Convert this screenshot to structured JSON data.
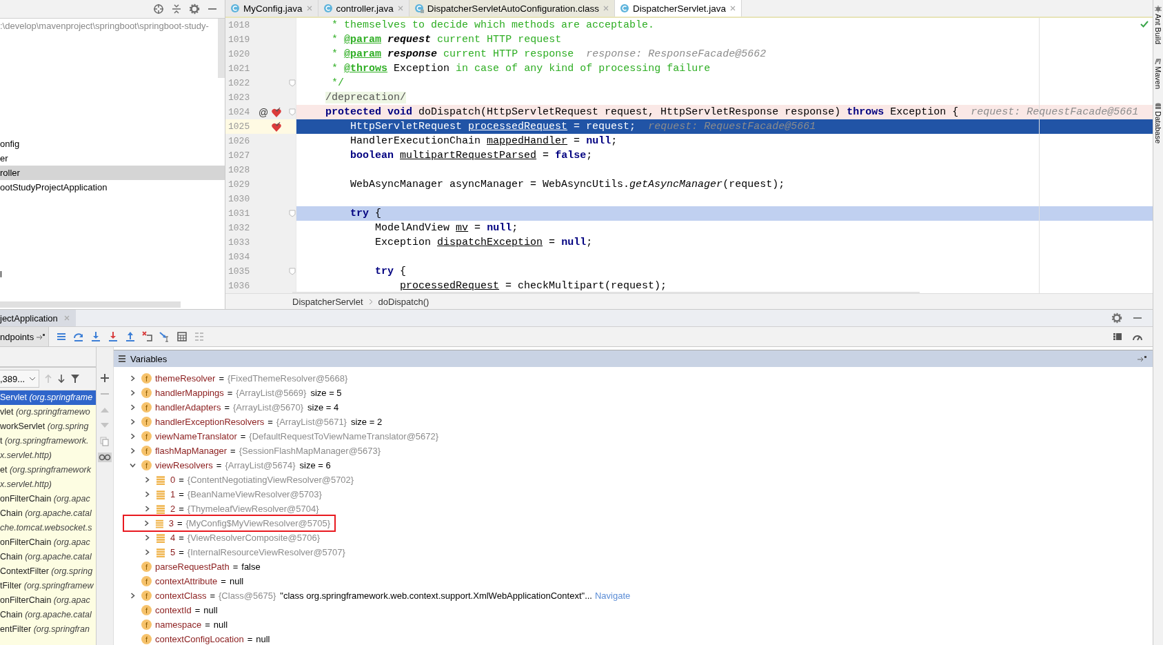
{
  "project_panel": {
    "path": ":\\develop\\mavenproject\\springboot\\springboot-study-",
    "items": [
      {
        "label": "onfig",
        "selected": false
      },
      {
        "label": "er",
        "selected": false
      },
      {
        "label": "roller",
        "selected": true
      },
      {
        "label": "ootStudyProjectApplication",
        "selected": false
      },
      {
        "label": "l",
        "selected": false
      }
    ]
  },
  "editor": {
    "tabs": [
      {
        "label": "MyConfig.java",
        "kind": "java",
        "selected": false
      },
      {
        "label": "controller.java",
        "kind": "java",
        "selected": false
      },
      {
        "label": "DispatcherServletAutoConfiguration.class",
        "kind": "class",
        "selected": false
      },
      {
        "label": "DispatcherServlet.java",
        "kind": "java",
        "selected": true
      }
    ],
    "lines": [
      {
        "number": "1018",
        "kind": "normal",
        "breakpoint": false,
        "fold": false,
        "segments": [
          {
            "kind": "comment",
            "text": "     * themselves to decide which methods are acceptable."
          }
        ]
      },
      {
        "number": "1019",
        "kind": "normal",
        "breakpoint": false,
        "fold": false,
        "segments": [
          {
            "kind": "comment",
            "text": "     *"
          },
          {
            "kind": "tag",
            "text": " @param"
          },
          {
            "kind": "param",
            "text": " request"
          },
          {
            "kind": "comment",
            "text": " current HTTP request"
          }
        ]
      },
      {
        "number": "1020",
        "kind": "normal",
        "breakpoint": false,
        "fold": false,
        "segments": [
          {
            "kind": "comment",
            "text": "     *"
          },
          {
            "kind": "tag",
            "text": " @param"
          },
          {
            "kind": "param",
            "text": " response"
          },
          {
            "kind": "comment",
            "text": " current HTTP response"
          },
          {
            "kind": "hint",
            "text": "  response: ResponseFacade@5662"
          }
        ]
      },
      {
        "number": "1021",
        "kind": "normal",
        "breakpoint": false,
        "fold": false,
        "segments": [
          {
            "kind": "comment",
            "text": "     *"
          },
          {
            "kind": "tag",
            "text": " @throws"
          },
          {
            "kind": "plain",
            "text": " Exception"
          },
          {
            "kind": "comment",
            "text": " in case of any kind of processing failure"
          }
        ]
      },
      {
        "number": "1022",
        "kind": "normal",
        "breakpoint": false,
        "fold": true,
        "segments": [
          {
            "kind": "comment",
            "text": "     */"
          }
        ]
      },
      {
        "number": "1023",
        "kind": "normal",
        "breakpoint": false,
        "fold": false,
        "segments": [
          {
            "kind": "annot",
            "text": "    /deprecation/"
          }
        ]
      },
      {
        "number": "1024",
        "kind": "breakpoint",
        "breakpoint": true,
        "fold": true,
        "marker": "@",
        "segments": [
          {
            "kind": "kw",
            "text": "    protected void"
          },
          {
            "kind": "plain",
            "text": " doDispatch(HttpServletRequest request, HttpServletResponse response) "
          },
          {
            "kind": "kw",
            "text": "throws"
          },
          {
            "kind": "plain",
            "text": " Exception {"
          },
          {
            "kind": "hint",
            "text": "  request: RequestFacade@5661"
          }
        ]
      },
      {
        "number": "1025",
        "kind": "execution",
        "breakpoint": true,
        "fold": false,
        "segments": [
          {
            "kind": "plain",
            "text": "        HttpServletRequest"
          },
          {
            "kind": "var",
            "text": " processedRequest"
          },
          {
            "kind": "plain",
            "text": " = request;"
          },
          {
            "kind": "hint",
            "text": "  request: RequestFacade@5661"
          }
        ]
      },
      {
        "number": "1026",
        "kind": "normal",
        "breakpoint": false,
        "fold": false,
        "segments": [
          {
            "kind": "plain",
            "text": "        HandlerExecutionChain"
          },
          {
            "kind": "var",
            "text": " mappedHandler"
          },
          {
            "kind": "plain",
            "text": " ="
          },
          {
            "kind": "kw",
            "text": " null"
          },
          {
            "kind": "plain",
            "text": ";"
          }
        ]
      },
      {
        "number": "1027",
        "kind": "normal",
        "breakpoint": false,
        "fold": false,
        "segments": [
          {
            "kind": "kw",
            "text": "        boolean"
          },
          {
            "kind": "var",
            "text": " multipartRequestParsed"
          },
          {
            "kind": "plain",
            "text": " ="
          },
          {
            "kind": "kw",
            "text": " false"
          },
          {
            "kind": "plain",
            "text": ";"
          }
        ]
      },
      {
        "number": "1028",
        "kind": "normal",
        "breakpoint": false,
        "fold": false
      },
      {
        "number": "1029",
        "kind": "normal",
        "breakpoint": false,
        "fold": false,
        "segments": [
          {
            "kind": "plain",
            "text": "        WebAsyncManager asyncManager = WebAsyncUtils."
          },
          {
            "kind": "method",
            "text": "getAsyncManager"
          },
          {
            "kind": "plain",
            "text": "(request);"
          }
        ]
      },
      {
        "number": "1030",
        "kind": "normal",
        "breakpoint": false,
        "fold": false
      },
      {
        "number": "1031",
        "kind": "caret",
        "breakpoint": false,
        "fold": true,
        "segments": [
          {
            "kind": "kw",
            "text": "        try"
          },
          {
            "kind": "plain",
            "text": " {"
          }
        ]
      },
      {
        "number": "1032",
        "kind": "normal",
        "breakpoint": false,
        "fold": false,
        "segments": [
          {
            "kind": "plain",
            "text": "            ModelAndView"
          },
          {
            "kind": "var",
            "text": " mv"
          },
          {
            "kind": "plain",
            "text": " ="
          },
          {
            "kind": "kw",
            "text": " null"
          },
          {
            "kind": "plain",
            "text": ";"
          }
        ]
      },
      {
        "number": "1033",
        "kind": "normal",
        "breakpoint": false,
        "fold": false,
        "segments": [
          {
            "kind": "plain",
            "text": "            Exception"
          },
          {
            "kind": "var",
            "text": " dispatchException"
          },
          {
            "kind": "plain",
            "text": " ="
          },
          {
            "kind": "kw",
            "text": " null"
          },
          {
            "kind": "plain",
            "text": ";"
          }
        ]
      },
      {
        "number": "1034",
        "kind": "normal",
        "breakpoint": false,
        "fold": false
      },
      {
        "number": "1035",
        "kind": "normal",
        "breakpoint": false,
        "fold": true,
        "segments": [
          {
            "kind": "kw",
            "text": "            try"
          },
          {
            "kind": "plain",
            "text": " {"
          }
        ]
      },
      {
        "number": "1036",
        "kind": "normal",
        "breakpoint": false,
        "fold": false,
        "segments": [
          {
            "kind": "var",
            "text": "                processedRequest"
          },
          {
            "kind": "plain",
            "text": " = checkMultipart(request);"
          }
        ]
      }
    ],
    "breadcrumbs": [
      "DispatcherServlet",
      "doDispatch()"
    ]
  },
  "tool_strip": [
    "Ant Build",
    "Maven",
    "Database"
  ],
  "debug": {
    "tab": "jectApplication",
    "toolbar_label": "ndpoints",
    "frames_selector": ",389...",
    "frames": [
      {
        "name": "Servlet",
        "package": "(org.springframe",
        "selected": true
      },
      {
        "name": "vlet",
        "package": "(org.springframewo",
        "selected": false
      },
      {
        "name": "workServlet",
        "package": "(org.spring",
        "selected": false
      },
      {
        "name": "t",
        "package": "(org.springframework.",
        "selected": false
      },
      {
        "package": "x.servlet.http)",
        "selected": false
      },
      {
        "name": "et",
        "package": "(org.springframework",
        "selected": false
      },
      {
        "package": "x.servlet.http)",
        "selected": false
      },
      {
        "name": "onFilterChain",
        "package": "(org.apac",
        "selected": false
      },
      {
        "name": "Chain",
        "package": "(org.apache.catal",
        "selected": false
      },
      {
        "package": "che.tomcat.websocket.s",
        "selected": false
      },
      {
        "name": "onFilterChain",
        "package": "(org.apac",
        "selected": false
      },
      {
        "name": "Chain",
        "package": "(org.apache.catal",
        "selected": false
      },
      {
        "name": "ContextFilter",
        "package": "(org.spring",
        "selected": false
      },
      {
        "name": "tFilter",
        "package": "(org.springframew",
        "selected": false
      },
      {
        "name": "onFilterChain",
        "package": "(org.apac",
        "selected": false
      },
      {
        "name": "Chain",
        "package": "(org.apache.catal",
        "selected": false
      },
      {
        "name": "entFilter",
        "package": "(org.springfran",
        "selected": false
      }
    ],
    "variables_title": "Variables",
    "variables": [
      {
        "kind": "field",
        "badge": "f",
        "name": "themeResolver",
        "eq": "=",
        "ref": "{FixedThemeResolver@5668}",
        "expanded": false,
        "boxed": false
      },
      {
        "kind": "field",
        "badge": "f",
        "name": "handlerMappings",
        "eq": "=",
        "ref": "{ArrayList@5669}",
        "text": "size = 5",
        "expanded": false,
        "boxed": false
      },
      {
        "kind": "field",
        "badge": "f",
        "name": "handlerAdapters",
        "eq": "=",
        "ref": "{ArrayList@5670}",
        "text": "size = 4",
        "expanded": false,
        "boxed": false
      },
      {
        "kind": "field",
        "badge": "f",
        "name": "handlerExceptionResolvers",
        "eq": "=",
        "ref": "{ArrayList@5671}",
        "text": "size = 2",
        "expanded": false,
        "boxed": false
      },
      {
        "kind": "field",
        "badge": "f",
        "name": "viewNameTranslator",
        "eq": "=",
        "ref": "{DefaultRequestToViewNameTranslator@5672}",
        "expanded": false,
        "boxed": false
      },
      {
        "kind": "field",
        "badge": "f",
        "name": "flashMapManager",
        "eq": "=",
        "ref": "{SessionFlashMapManager@5673}",
        "expanded": false,
        "boxed": false
      },
      {
        "kind": "field",
        "badge": "f",
        "name": "viewResolvers",
        "eq": "=",
        "ref": "{ArrayList@5674}",
        "text": "size = 6",
        "expanded": true,
        "boxed": false,
        "children": [
          {
            "kind": "element",
            "name": "0",
            "eq": "=",
            "ref": "{ContentNegotiatingViewResolver@5702}",
            "expanded": false,
            "boxed": false
          },
          {
            "kind": "element",
            "name": "1",
            "eq": "=",
            "ref": "{BeanNameViewResolver@5703}",
            "expanded": false,
            "boxed": false
          },
          {
            "kind": "element",
            "name": "2",
            "eq": "=",
            "ref": "{ThymeleafViewResolver@5704}",
            "expanded": false,
            "boxed": false
          },
          {
            "kind": "element",
            "name": "3",
            "eq": "=",
            "ref": "{MyConfig$MyViewResolver@5705}",
            "expanded": false,
            "boxed": true
          },
          {
            "kind": "element",
            "name": "4",
            "eq": "=",
            "ref": "{ViewResolverComposite@5706}",
            "expanded": false,
            "boxed": false
          },
          {
            "kind": "element",
            "name": "5",
            "eq": "=",
            "ref": "{InternalResourceViewResolver@5707}",
            "expanded": false,
            "boxed": false
          }
        ]
      },
      {
        "kind": "field",
        "badge": "f",
        "name": "parseRequestPath",
        "eq": "=",
        "text": "false",
        "boxed": false
      },
      {
        "kind": "field",
        "badge": "f",
        "name": "contextAttribute",
        "eq": "=",
        "text": "null",
        "boxed": false
      },
      {
        "kind": "field",
        "badge": "f",
        "name": "contextClass",
        "eq": "=",
        "ref": "{Class@5675}",
        "text": "\"class org.springframework.web.context.support.XmlWebApplicationContext\"...",
        "link": "Navigate",
        "expanded": false,
        "boxed": false
      },
      {
        "kind": "field",
        "badge": "f",
        "name": "contextId",
        "eq": "=",
        "text": "null",
        "boxed": false
      },
      {
        "kind": "field",
        "badge": "f",
        "name": "namespace",
        "eq": "=",
        "text": "null",
        "boxed": false
      },
      {
        "kind": "field",
        "badge": "f",
        "name": "contextConfigLocation",
        "eq": "=",
        "text": "null",
        "boxed": false
      }
    ]
  }
}
